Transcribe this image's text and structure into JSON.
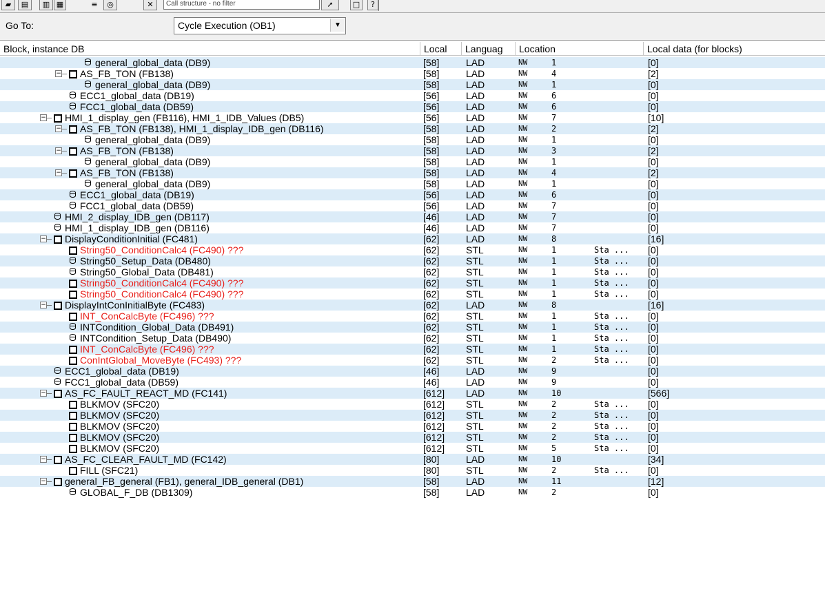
{
  "toolbar": {
    "filter_text": "Call structure - no filter",
    "buttons": [
      "open-icon",
      "print-icon",
      "tile-icon",
      "window-icon",
      "list-icon",
      "filter-icon",
      "delete-icon",
      "display-icon",
      "new-window-icon",
      "help-icon"
    ]
  },
  "goto": {
    "label": "Go To:",
    "selected": "Cycle Execution (OB1)"
  },
  "columns": {
    "block": "Block, instance DB",
    "local": "Local",
    "language": "Languag",
    "location": "Location",
    "local_data": "Local data (for blocks)"
  },
  "colors": {
    "row_alt": "#dcecf8",
    "missing": "#e8211c"
  },
  "rows": [
    {
      "indent": 4,
      "icon": "db",
      "exp": false,
      "name": "general_global_data (DB9)",
      "red": false,
      "local": "[58]",
      "lang": "LAD",
      "nw": "NW",
      "num": "1",
      "sta": "",
      "ld": "[0]"
    },
    {
      "indent": 3,
      "icon": "block",
      "exp": true,
      "name": "AS_FB_TON (FB138)",
      "red": false,
      "local": "[58]",
      "lang": "LAD",
      "nw": "NW",
      "num": "4",
      "sta": "",
      "ld": "[2]"
    },
    {
      "indent": 4,
      "icon": "db",
      "exp": false,
      "name": "general_global_data (DB9)",
      "red": false,
      "local": "[58]",
      "lang": "LAD",
      "nw": "NW",
      "num": "1",
      "sta": "",
      "ld": "[0]"
    },
    {
      "indent": 3,
      "icon": "db",
      "exp": false,
      "name": "ECC1_global_data (DB19)",
      "red": false,
      "local": "[56]",
      "lang": "LAD",
      "nw": "NW",
      "num": "6",
      "sta": "",
      "ld": "[0]"
    },
    {
      "indent": 3,
      "icon": "db",
      "exp": false,
      "name": "FCC1_global_data (DB59)",
      "red": false,
      "local": "[56]",
      "lang": "LAD",
      "nw": "NW",
      "num": "6",
      "sta": "",
      "ld": "[0]"
    },
    {
      "indent": 2,
      "icon": "block",
      "exp": true,
      "name": "HMI_1_display_gen (FB116), HMI_1_IDB_Values (DB5)",
      "red": false,
      "local": "[56]",
      "lang": "LAD",
      "nw": "NW",
      "num": "7",
      "sta": "",
      "ld": "[10]"
    },
    {
      "indent": 3,
      "icon": "block",
      "exp": true,
      "name": "AS_FB_TON (FB138), HMI_1_display_IDB_gen (DB116)",
      "red": false,
      "local": "[58]",
      "lang": "LAD",
      "nw": "NW",
      "num": "2",
      "sta": "",
      "ld": "[2]"
    },
    {
      "indent": 4,
      "icon": "db",
      "exp": false,
      "name": "general_global_data (DB9)",
      "red": false,
      "local": "[58]",
      "lang": "LAD",
      "nw": "NW",
      "num": "1",
      "sta": "",
      "ld": "[0]"
    },
    {
      "indent": 3,
      "icon": "block",
      "exp": true,
      "name": "AS_FB_TON (FB138)",
      "red": false,
      "local": "[58]",
      "lang": "LAD",
      "nw": "NW",
      "num": "3",
      "sta": "",
      "ld": "[2]"
    },
    {
      "indent": 4,
      "icon": "db",
      "exp": false,
      "name": "general_global_data (DB9)",
      "red": false,
      "local": "[58]",
      "lang": "LAD",
      "nw": "NW",
      "num": "1",
      "sta": "",
      "ld": "[0]"
    },
    {
      "indent": 3,
      "icon": "block",
      "exp": true,
      "name": "AS_FB_TON (FB138)",
      "red": false,
      "local": "[58]",
      "lang": "LAD",
      "nw": "NW",
      "num": "4",
      "sta": "",
      "ld": "[2]"
    },
    {
      "indent": 4,
      "icon": "db",
      "exp": false,
      "name": "general_global_data (DB9)",
      "red": false,
      "local": "[58]",
      "lang": "LAD",
      "nw": "NW",
      "num": "1",
      "sta": "",
      "ld": "[0]"
    },
    {
      "indent": 3,
      "icon": "db",
      "exp": false,
      "name": "ECC1_global_data (DB19)",
      "red": false,
      "local": "[56]",
      "lang": "LAD",
      "nw": "NW",
      "num": "6",
      "sta": "",
      "ld": "[0]"
    },
    {
      "indent": 3,
      "icon": "db",
      "exp": false,
      "name": "FCC1_global_data (DB59)",
      "red": false,
      "local": "[56]",
      "lang": "LAD",
      "nw": "NW",
      "num": "7",
      "sta": "",
      "ld": "[0]"
    },
    {
      "indent": 2,
      "icon": "db",
      "exp": false,
      "name": "HMI_2_display_IDB_gen (DB117)",
      "red": false,
      "local": "[46]",
      "lang": "LAD",
      "nw": "NW",
      "num": "7",
      "sta": "",
      "ld": "[0]"
    },
    {
      "indent": 2,
      "icon": "db",
      "exp": false,
      "name": "HMI_1_display_IDB_gen (DB116)",
      "red": false,
      "local": "[46]",
      "lang": "LAD",
      "nw": "NW",
      "num": "7",
      "sta": "",
      "ld": "[0]"
    },
    {
      "indent": 2,
      "icon": "block",
      "exp": true,
      "name": "DisplayConditionInitial (FC481)",
      "red": false,
      "local": "[62]",
      "lang": "LAD",
      "nw": "NW",
      "num": "8",
      "sta": "",
      "ld": "[16]"
    },
    {
      "indent": 3,
      "icon": "block",
      "exp": false,
      "name": "String50_ConditionCalc4 (FC490) ???",
      "red": true,
      "local": "[62]",
      "lang": "STL",
      "nw": "NW",
      "num": "1",
      "sta": "Sta ...",
      "ld": "[0]"
    },
    {
      "indent": 3,
      "icon": "db",
      "exp": false,
      "name": "String50_Setup_Data (DB480)",
      "red": false,
      "local": "[62]",
      "lang": "STL",
      "nw": "NW",
      "num": "1",
      "sta": "Sta ...",
      "ld": "[0]"
    },
    {
      "indent": 3,
      "icon": "db",
      "exp": false,
      "name": "String50_Global_Data (DB481)",
      "red": false,
      "local": "[62]",
      "lang": "STL",
      "nw": "NW",
      "num": "1",
      "sta": "Sta ...",
      "ld": "[0]"
    },
    {
      "indent": 3,
      "icon": "block",
      "exp": false,
      "name": "String50_ConditionCalc4 (FC490) ???",
      "red": true,
      "local": "[62]",
      "lang": "STL",
      "nw": "NW",
      "num": "1",
      "sta": "Sta ...",
      "ld": "[0]"
    },
    {
      "indent": 3,
      "icon": "block",
      "exp": false,
      "name": "String50_ConditionCalc4 (FC490) ???",
      "red": true,
      "local": "[62]",
      "lang": "STL",
      "nw": "NW",
      "num": "1",
      "sta": "Sta ...",
      "ld": "[0]"
    },
    {
      "indent": 2,
      "icon": "block",
      "exp": true,
      "name": "DisplayIntConInitialByte (FC483)",
      "red": false,
      "local": "[62]",
      "lang": "LAD",
      "nw": "NW",
      "num": "8",
      "sta": "",
      "ld": "[16]"
    },
    {
      "indent": 3,
      "icon": "block",
      "exp": false,
      "name": "INT_ConCalcByte (FC496) ???",
      "red": true,
      "local": "[62]",
      "lang": "STL",
      "nw": "NW",
      "num": "1",
      "sta": "Sta ...",
      "ld": "[0]"
    },
    {
      "indent": 3,
      "icon": "db",
      "exp": false,
      "name": "INTCondition_Global_Data (DB491)",
      "red": false,
      "local": "[62]",
      "lang": "STL",
      "nw": "NW",
      "num": "1",
      "sta": "Sta ...",
      "ld": "[0]"
    },
    {
      "indent": 3,
      "icon": "db",
      "exp": false,
      "name": "INTCondition_Setup_Data (DB490)",
      "red": false,
      "local": "[62]",
      "lang": "STL",
      "nw": "NW",
      "num": "1",
      "sta": "Sta ...",
      "ld": "[0]"
    },
    {
      "indent": 3,
      "icon": "block",
      "exp": false,
      "name": "INT_ConCalcByte (FC496) ???",
      "red": true,
      "local": "[62]",
      "lang": "STL",
      "nw": "NW",
      "num": "1",
      "sta": "Sta ...",
      "ld": "[0]"
    },
    {
      "indent": 3,
      "icon": "block",
      "exp": false,
      "name": "ConIntGlobal_MoveByte (FC493) ???",
      "red": true,
      "local": "[62]",
      "lang": "STL",
      "nw": "NW",
      "num": "2",
      "sta": "Sta ...",
      "ld": "[0]"
    },
    {
      "indent": 2,
      "icon": "db",
      "exp": false,
      "name": "ECC1_global_data (DB19)",
      "red": false,
      "local": "[46]",
      "lang": "LAD",
      "nw": "NW",
      "num": "9",
      "sta": "",
      "ld": "[0]"
    },
    {
      "indent": 2,
      "icon": "db",
      "exp": false,
      "name": "FCC1_global_data (DB59)",
      "red": false,
      "local": "[46]",
      "lang": "LAD",
      "nw": "NW",
      "num": "9",
      "sta": "",
      "ld": "[0]"
    },
    {
      "indent": 2,
      "icon": "block",
      "exp": true,
      "name": "AS_FC_FAULT_REACT_MD (FC141)",
      "red": false,
      "local": "[612]",
      "lang": "LAD",
      "nw": "NW",
      "num": "10",
      "sta": "",
      "ld": "[566]"
    },
    {
      "indent": 3,
      "icon": "block",
      "exp": false,
      "name": "BLKMOV (SFC20)",
      "red": false,
      "local": "[612]",
      "lang": "STL",
      "nw": "NW",
      "num": "2",
      "sta": "Sta ...",
      "ld": "[0]"
    },
    {
      "indent": 3,
      "icon": "block",
      "exp": false,
      "name": "BLKMOV (SFC20)",
      "red": false,
      "local": "[612]",
      "lang": "STL",
      "nw": "NW",
      "num": "2",
      "sta": "Sta ...",
      "ld": "[0]"
    },
    {
      "indent": 3,
      "icon": "block",
      "exp": false,
      "name": "BLKMOV (SFC20)",
      "red": false,
      "local": "[612]",
      "lang": "STL",
      "nw": "NW",
      "num": "2",
      "sta": "Sta ...",
      "ld": "[0]"
    },
    {
      "indent": 3,
      "icon": "block",
      "exp": false,
      "name": "BLKMOV (SFC20)",
      "red": false,
      "local": "[612]",
      "lang": "STL",
      "nw": "NW",
      "num": "2",
      "sta": "Sta ...",
      "ld": "[0]"
    },
    {
      "indent": 3,
      "icon": "block",
      "exp": false,
      "name": "BLKMOV (SFC20)",
      "red": false,
      "local": "[612]",
      "lang": "STL",
      "nw": "NW",
      "num": "5",
      "sta": "Sta ...",
      "ld": "[0]"
    },
    {
      "indent": 2,
      "icon": "block",
      "exp": true,
      "name": "AS_FC_CLEAR_FAULT_MD (FC142)",
      "red": false,
      "local": "[80]",
      "lang": "LAD",
      "nw": "NW",
      "num": "10",
      "sta": "",
      "ld": "[34]"
    },
    {
      "indent": 3,
      "icon": "block",
      "exp": false,
      "name": "FILL (SFC21)",
      "red": false,
      "local": "[80]",
      "lang": "STL",
      "nw": "NW",
      "num": "2",
      "sta": "Sta ...",
      "ld": "[0]"
    },
    {
      "indent": 2,
      "icon": "block",
      "exp": true,
      "name": "general_FB_general (FB1), general_IDB_general (DB1)",
      "red": false,
      "local": "[58]",
      "lang": "LAD",
      "nw": "NW",
      "num": "11",
      "sta": "",
      "ld": "[12]"
    },
    {
      "indent": 3,
      "icon": "db",
      "exp": false,
      "name": "GLOBAL_F_DB (DB1309)",
      "red": false,
      "local": "[58]",
      "lang": "LAD",
      "nw": "NW",
      "num": "2",
      "sta": "",
      "ld": "[0]"
    }
  ]
}
